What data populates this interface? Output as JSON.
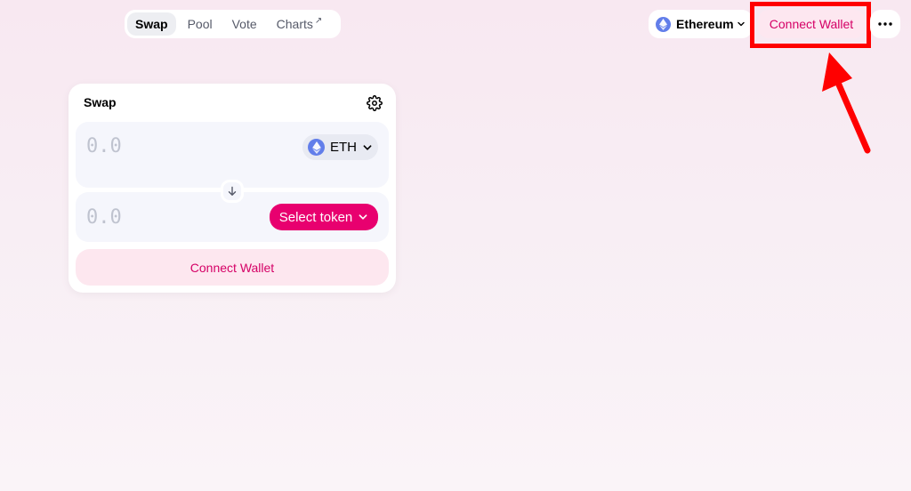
{
  "nav": {
    "tabs": [
      {
        "label": "Swap",
        "active": true
      },
      {
        "label": "Pool",
        "active": false
      },
      {
        "label": "Vote",
        "active": false
      },
      {
        "label": "Charts",
        "active": false,
        "external": true
      }
    ],
    "external_icon": "↗"
  },
  "header": {
    "network_label": "Ethereum",
    "network_icon": "ethereum-icon",
    "connect_label": "Connect Wallet",
    "more_icon": "more-horizontal-icon"
  },
  "annotation": {
    "highlight_color": "#ff0000",
    "target": "connect-wallet-header-button"
  },
  "swap": {
    "title": "Swap",
    "settings_icon": "gear-icon",
    "input": {
      "placeholder": "0.0",
      "value": "",
      "token": "ETH"
    },
    "output": {
      "placeholder": "0.0",
      "value": "",
      "select_label": "Select token"
    },
    "switch_icon": "arrow-down-icon",
    "connect_label": "Connect Wallet"
  },
  "colors": {
    "accent": "#e8006f",
    "accent_soft": "#fde7ef",
    "accent_text": "#d50066",
    "eth": "#627eea"
  }
}
